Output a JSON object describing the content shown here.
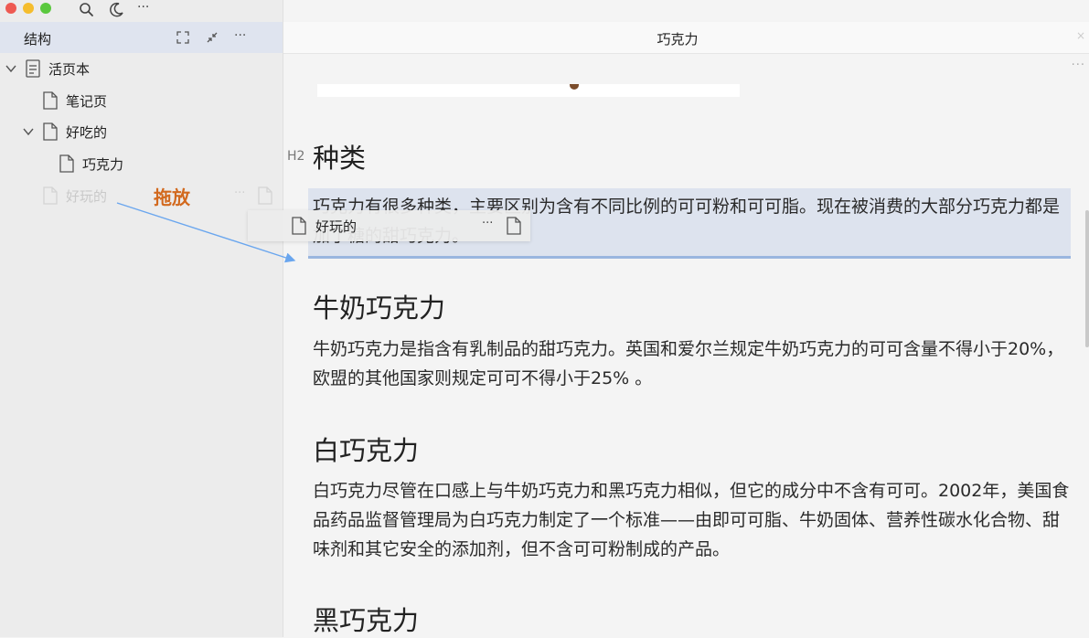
{
  "toolbar": {
    "search_icon": "search-icon",
    "theme_icon": "moon-icon",
    "more_label": "···"
  },
  "sidebar": {
    "title": "结构",
    "header_more": "···",
    "tree": [
      {
        "label": "活页本",
        "icon": "notebook-icon",
        "expanded": true
      },
      {
        "label": "笔记页",
        "icon": "page-icon"
      },
      {
        "label": "好吃的",
        "icon": "page-icon",
        "expanded": true
      },
      {
        "label": "巧克力",
        "icon": "page-icon"
      },
      {
        "label": "好玩的",
        "icon": "page-icon",
        "dragging": true
      }
    ],
    "row_more": "···",
    "drag_annotation": "拖放",
    "drag_ghost": {
      "label": "好玩的",
      "more": "···"
    }
  },
  "tab": {
    "title": "巧克力",
    "close": "×"
  },
  "content_more": "···",
  "document": {
    "h2_marker": "H2",
    "sections": [
      {
        "heading": "种类",
        "body": "巧克力有很多种类，主要区别为含有不同比例的可可粉和可可脂。现在被消费的大部分巧克力都是加了糖的甜巧克力。"
      },
      {
        "heading": "牛奶巧克力",
        "body": "牛奶巧克力是指含有乳制品的甜巧克力。英国和爱尔兰规定牛奶巧克力的可可含量不得小于20%，欧盟的其他国家则规定可可不得小于25% 。"
      },
      {
        "heading": "白巧克力",
        "body": "白巧克力尽管在口感上与牛奶巧克力和黑巧克力相似，但它的成分中不含有可可。2002年，美国食品药品监督管理局为白巧克力制定了一个标准——由即可可脂、牛奶固体、营养性碳水化合物、甜味剂和其它安全的添加剂，但不含可可粉制成的产品。"
      },
      {
        "heading": "黑巧克力"
      }
    ]
  },
  "colors": {
    "accent": "#9ab6df",
    "selection": "#dde3ee",
    "annotation": "#d2691e",
    "arrow": "#6aa6ee"
  }
}
